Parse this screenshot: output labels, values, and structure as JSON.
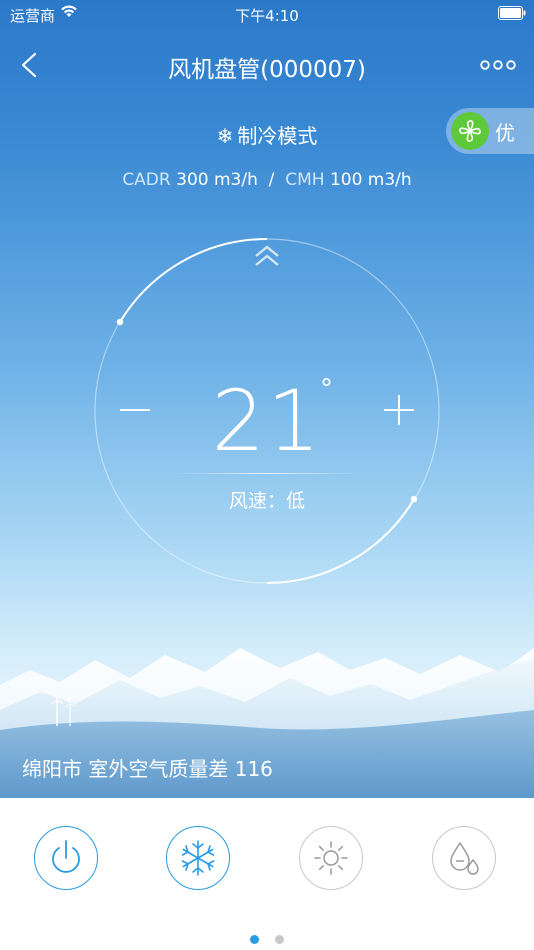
{
  "status_bar": {
    "carrier": "运营商",
    "time": "下午4:10"
  },
  "header": {
    "title": "风机盘管(000007)"
  },
  "mode": {
    "label": "制冷模式"
  },
  "air_quality_badge": {
    "label": "优",
    "color": "#5ec93b"
  },
  "flow": {
    "cadr_label": "CADR",
    "cadr_value": "300 m3/h",
    "separator": "/",
    "cmh_label": "CMH",
    "cmh_value": "100 m3/h"
  },
  "thermostat": {
    "temperature": "21",
    "unit": "°",
    "fan_speed_label": "风速：低"
  },
  "outdoor": {
    "text": "绵阳市 室外空气质量差 116"
  },
  "controls": [
    {
      "name": "power",
      "icon": "power-icon",
      "state": "active"
    },
    {
      "name": "cool",
      "icon": "snowflake-icon",
      "state": "active"
    },
    {
      "name": "heat",
      "icon": "sun-icon",
      "state": "inactive"
    },
    {
      "name": "dry",
      "icon": "droplets-icon",
      "state": "inactive"
    }
  ],
  "pagination": {
    "total": 2,
    "current": 1
  },
  "colors": {
    "accent": "#2a9be2",
    "badge_green": "#5ec93b",
    "inactive": "#c9c9c9"
  }
}
